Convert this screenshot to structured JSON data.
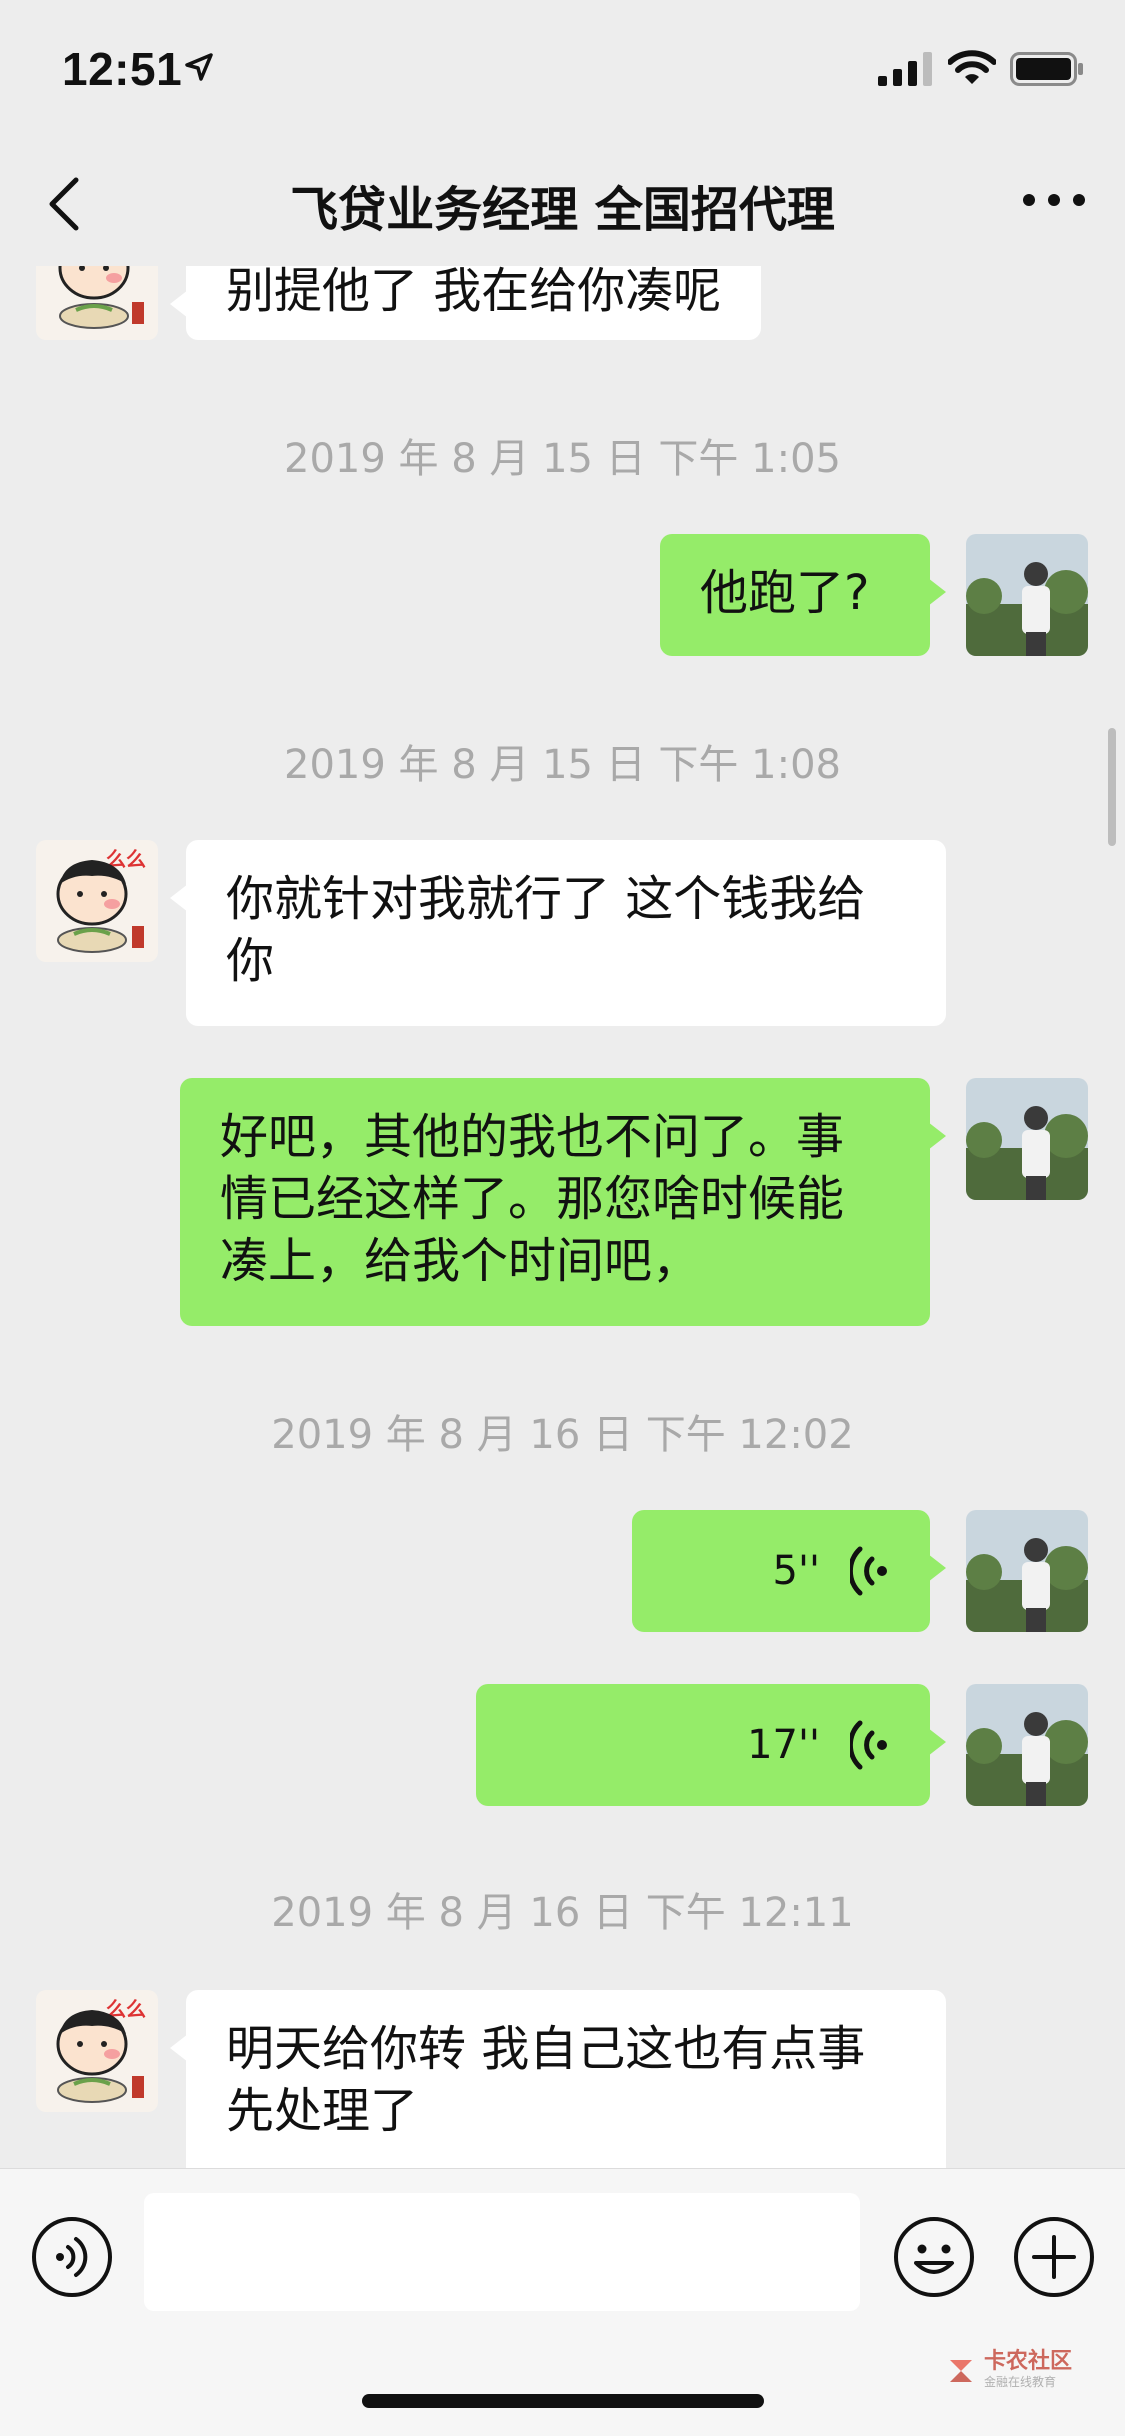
{
  "status_bar": {
    "time": "12:51"
  },
  "nav": {
    "title": "飞贷业务经理 全国招代理"
  },
  "messages": [
    {
      "type": "text",
      "side": "in",
      "text": "别提他了 我在给你凑呢"
    },
    {
      "type": "timestamp",
      "text": "2019 年 8 月 15 日 下午 1:05"
    },
    {
      "type": "text",
      "side": "out",
      "text": "他跑了?"
    },
    {
      "type": "timestamp",
      "text": "2019 年 8 月 15 日 下午 1:08"
    },
    {
      "type": "text",
      "side": "in",
      "text": "你就针对我就行了 这个钱我给你"
    },
    {
      "type": "text",
      "side": "out",
      "text": "好吧，其他的我也不问了。事情已经这样了。那您啥时候能凑上，给我个时间吧，"
    },
    {
      "type": "timestamp",
      "text": "2019 年 8 月 16 日 下午 12:02"
    },
    {
      "type": "voice",
      "side": "out",
      "duration": "5''"
    },
    {
      "type": "voice",
      "side": "out",
      "duration": "17''"
    },
    {
      "type": "timestamp",
      "text": "2019 年 8 月 16 日 下午 12:11"
    },
    {
      "type": "text",
      "side": "in",
      "text": "明天给你转 我自己这也有点事先处理了"
    }
  ],
  "input_bar": {
    "placeholder": ""
  },
  "watermark": {
    "title": "卡农社区",
    "subtitle": "金融在线教育"
  },
  "colors": {
    "background": "#ededed",
    "outgoing_bubble": "#95ec69",
    "incoming_bubble": "#ffffff",
    "timestamp_text": "#a9a9a9"
  },
  "icons": {
    "back": "chevron-left-icon",
    "more": "more-dots-icon",
    "voice_input": "voice-input-icon",
    "emoji": "emoji-icon",
    "plus": "plus-icon",
    "voice_wave": "voice-wave-icon"
  }
}
